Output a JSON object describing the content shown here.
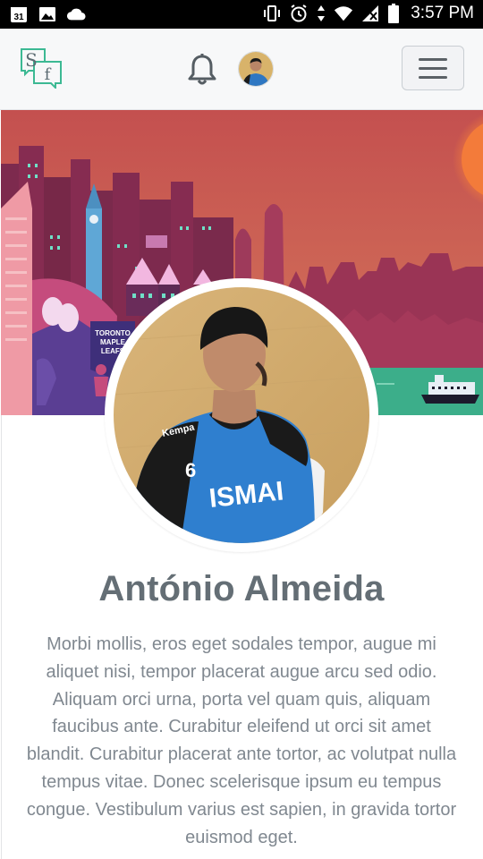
{
  "status_bar": {
    "time": "3:57 PM",
    "calendar_day": "31",
    "icons_left": [
      "calendar-icon",
      "image-icon",
      "cloud-icon"
    ],
    "icons_right": [
      "vibrate-icon",
      "alarm-icon",
      "data-arrows-icon",
      "wifi-icon",
      "signal-icon",
      "battery-icon"
    ]
  },
  "navbar": {
    "logo_letters": [
      "S",
      "f"
    ],
    "icons": [
      "bell-icon",
      "avatar",
      "hamburger-menu-icon"
    ]
  },
  "banner": {
    "sign_text": [
      "TORONTO",
      "MAPLE",
      "LEAFS"
    ]
  },
  "profile": {
    "jersey_brand": "Kempa",
    "jersey_number": "6",
    "jersey_text": "ISMAI",
    "name": "António Almeida",
    "bio": "Morbi mollis, eros eget sodales tempor, augue mi aliquet nisi, tempor placerat augue arcu sed odio. Aliquam orci urna, porta vel quam quis, aliquam faucibus ante. Curabitur eleifend ut orci sit amet blandit. Curabitur placerat ante tortor, ac volutpat nulla tempus vitae. Donec scelerisque ipsum eu tempus congue. Vestibulum varius est sapien, in gravida tortor euismod eget."
  },
  "colors": {
    "sky": "#c85a52",
    "buildings": "#8e2f55",
    "sea": "#3cae8a",
    "sun": "#f07a3c",
    "name_text": "#646e75",
    "bio_text": "#808890",
    "logo_green": "#3cb993"
  }
}
